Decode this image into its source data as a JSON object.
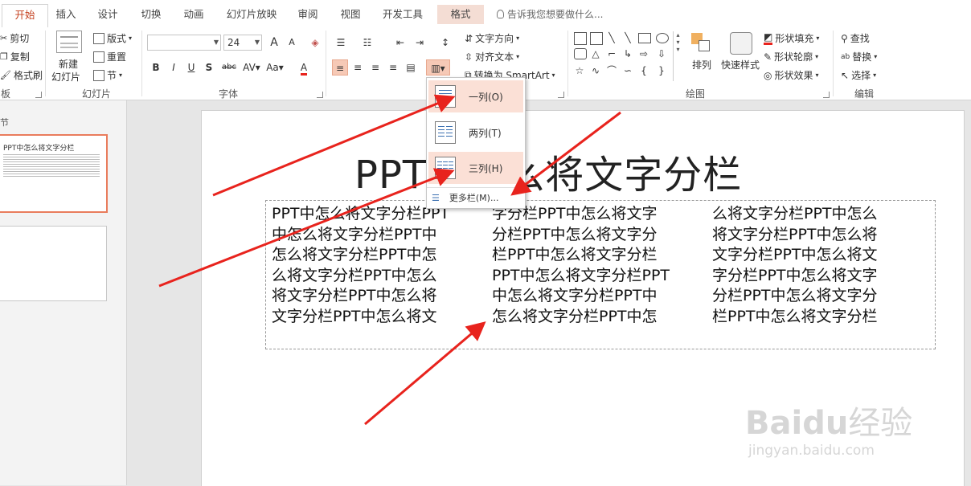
{
  "tabs": [
    "开始",
    "插入",
    "设计",
    "切换",
    "动画",
    "幻灯片放映",
    "审阅",
    "视图",
    "开发工具",
    "格式"
  ],
  "tell_me": "告诉我您想要做什么...",
  "clipboard": {
    "cut": "剪切",
    "copy": "复制",
    "format_painter": "格式刷",
    "group_label": "板"
  },
  "slides_group": {
    "new_slide": "新建",
    "new_slide2": "幻灯片",
    "layout": "版式",
    "reset": "重置",
    "section": "节",
    "group_label": "幻灯片"
  },
  "font": {
    "font_name": "",
    "font_size": "24",
    "group_label": "字体",
    "bold": "B",
    "italic": "I",
    "underline": "U",
    "shadow": "S",
    "strike": "abc",
    "aa": "Aa",
    "grow": "A",
    "shrink": "A"
  },
  "paragraph": {
    "text_direction": "文字方向",
    "align_text": "对齐文本",
    "smartart": "转换为 SmartArt"
  },
  "drawing": {
    "arrange": "排列",
    "quick_styles": "快速样式",
    "fill": "形状填充",
    "outline": "形状轮廓",
    "effects": "形状效果",
    "group_label": "绘图"
  },
  "editing": {
    "find": "查找",
    "replace": "替换",
    "select": "选择",
    "group_label": "编辑"
  },
  "columns_menu": {
    "one": "一列(O)",
    "two": "两列(T)",
    "three": "三列(H)",
    "more": "更多栏(M)..."
  },
  "left_pane": {
    "section_label": "节",
    "thumb_title": "PPT中怎么将文字分栏"
  },
  "slide": {
    "title": "PPT中怎么将文字分栏",
    "columns": [
      [
        "PPT中怎么将文字分栏PPT",
        "中怎么将文字分栏PPT中",
        "怎么将文字分栏PPT中怎",
        "么将文字分栏PPT中怎么",
        "将文字分栏PPT中怎么将",
        "文字分栏PPT中怎么将文"
      ],
      [
        "字分栏PPT中怎么将文字",
        "分栏PPT中怎么将文字分",
        "栏PPT中怎么将文字分栏",
        "PPT中怎么将文字分栏PPT",
        "中怎么将文字分栏PPT中",
        "怎么将文字分栏PPT中怎"
      ],
      [
        "么将文字分栏PPT中怎么",
        "将文字分栏PPT中怎么将",
        "文字分栏PPT中怎么将文",
        "字分栏PPT中怎么将文字",
        "分栏PPT中怎么将文字分",
        "栏PPT中怎么将文字分栏"
      ]
    ]
  },
  "watermark": {
    "brand": "Bai",
    "brand2": "du",
    "product": "经验",
    "url": "jingyan.baidu.com"
  },
  "colors": {
    "accent": "#c43e1c",
    "arrow": "#e8231d",
    "highlight": "#fbe0d6",
    "active_btn": "#f6c9b6"
  }
}
